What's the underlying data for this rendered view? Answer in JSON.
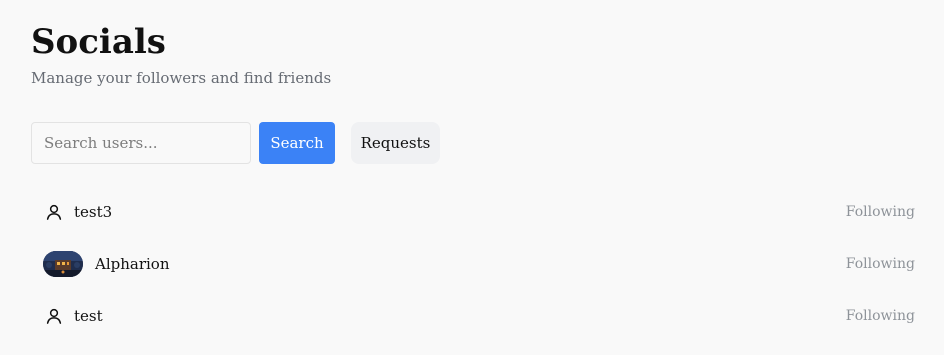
{
  "header": {
    "title": "Socials",
    "subtitle": "Manage your followers and find friends"
  },
  "search": {
    "placeholder": "Search users...",
    "value": "",
    "button_label": "Search"
  },
  "requests": {
    "label": "Requests"
  },
  "users": [
    {
      "name": "test3",
      "status": "Following",
      "avatar": "user-icon"
    },
    {
      "name": "Alpharion",
      "status": "Following",
      "avatar": "image"
    },
    {
      "name": "test",
      "status": "Following",
      "avatar": "user-icon"
    }
  ],
  "colors": {
    "accent": "#3b82f6",
    "background": "#f9f9f9",
    "muted_text": "#8e9399",
    "subtitle_text": "#666b73"
  }
}
